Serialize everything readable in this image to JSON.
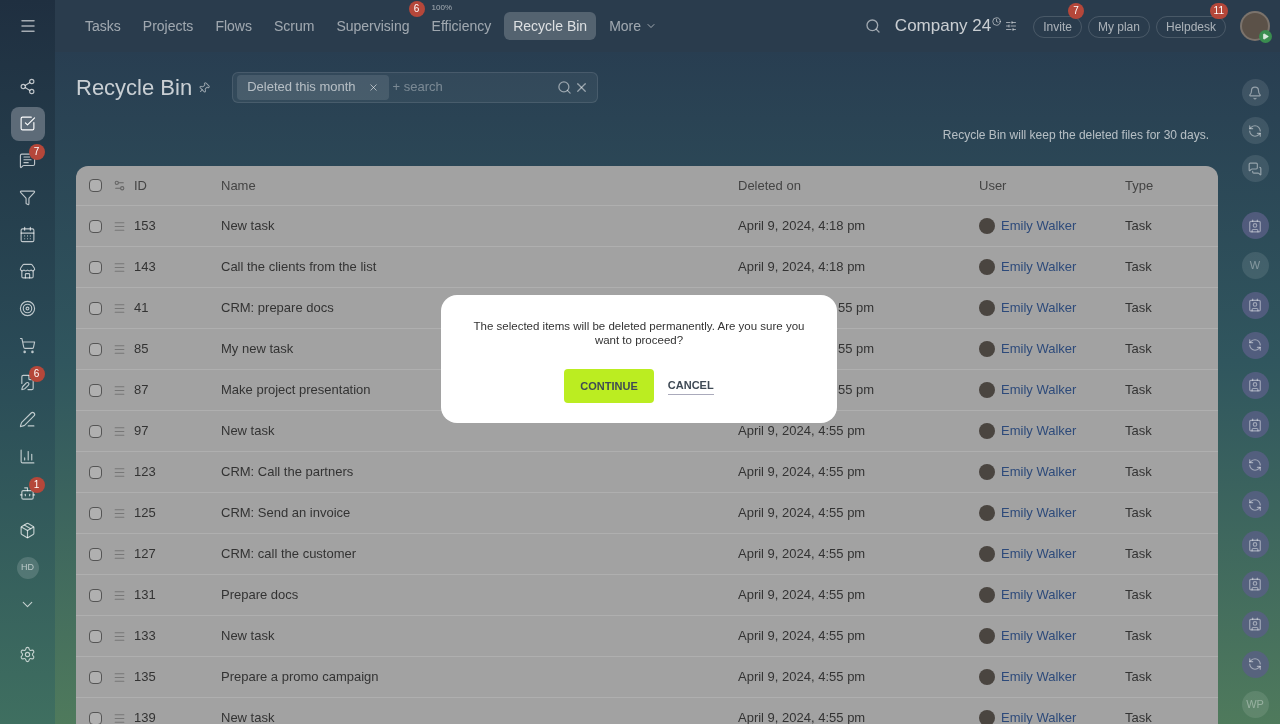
{
  "nav": {
    "items": [
      {
        "label": "Tasks",
        "selected": false
      },
      {
        "label": "Projects",
        "selected": false
      },
      {
        "label": "Flows",
        "selected": false
      },
      {
        "label": "Scrum",
        "selected": false
      },
      {
        "label": "Supervising",
        "selected": false,
        "badge": "6"
      },
      {
        "label": "Efficiency",
        "selected": false,
        "caption": "100%"
      },
      {
        "label": "Recycle Bin",
        "selected": true
      },
      {
        "label": "More",
        "selected": false,
        "dropdown": true
      }
    ],
    "company": "Company 24",
    "buttons": [
      {
        "label": "Invite",
        "badge": "7"
      },
      {
        "label": "My plan"
      },
      {
        "label": "Helpdesk",
        "badge": "11"
      }
    ]
  },
  "left_sidebar": [
    {
      "kind": "feed",
      "selected": false
    },
    {
      "kind": "tasks",
      "selected": true
    },
    {
      "kind": "chat",
      "selected": false,
      "badge": "7"
    },
    {
      "kind": "funnel",
      "selected": false
    },
    {
      "kind": "calendar",
      "selected": false
    },
    {
      "kind": "store",
      "selected": false
    },
    {
      "kind": "target",
      "selected": false
    },
    {
      "kind": "cart",
      "selected": false
    },
    {
      "kind": "docs",
      "selected": false,
      "badge": "6"
    },
    {
      "kind": "pen",
      "selected": false
    },
    {
      "kind": "chart",
      "selected": false
    },
    {
      "kind": "robot",
      "selected": false,
      "badge": "1"
    },
    {
      "kind": "box",
      "selected": false
    },
    {
      "kind": "initials",
      "selected": false,
      "text": "HD"
    },
    {
      "kind": "more",
      "selected": false
    },
    {
      "kind": "settings",
      "selected": false
    }
  ],
  "page": {
    "title": "Recycle Bin",
    "filter": {
      "tag": "Deleted this month",
      "placeholder": "+ search"
    },
    "note": "Recycle Bin will keep the deleted files for 30 days."
  },
  "table": {
    "all_checked": false,
    "columns": [
      "ID",
      "Name",
      "Deleted on",
      "User",
      "Type"
    ],
    "rows": [
      {
        "id": "153",
        "name": "New task",
        "deleted_on": "April 9, 2024, 4:18 pm",
        "user": "Emily Walker",
        "type": "Task",
        "checked": false
      },
      {
        "id": "143",
        "name": "Call the clients from the list",
        "deleted_on": "April 9, 2024, 4:18 pm",
        "user": "Emily Walker",
        "type": "Task",
        "checked": false
      },
      {
        "id": "41",
        "name": "CRM: prepare docs",
        "deleted_on": "55 pm",
        "covered": true,
        "user": "Emily Walker",
        "type": "Task",
        "checked": false
      },
      {
        "id": "85",
        "name": "My new task",
        "deleted_on": "55 pm",
        "covered": true,
        "user": "Emily Walker",
        "type": "Task",
        "checked": false
      },
      {
        "id": "87",
        "name": "Make project presentation",
        "deleted_on": "55 pm",
        "covered": true,
        "user": "Emily Walker",
        "type": "Task",
        "checked": false
      },
      {
        "id": "97",
        "name": "New task",
        "deleted_on": "April 9, 2024, 4:55 pm",
        "user": "Emily Walker",
        "type": "Task",
        "checked": false
      },
      {
        "id": "123",
        "name": "CRM: Call the partners",
        "deleted_on": "April 9, 2024, 4:55 pm",
        "user": "Emily Walker",
        "type": "Task",
        "checked": false
      },
      {
        "id": "125",
        "name": "CRM: Send an invoice",
        "deleted_on": "April 9, 2024, 4:55 pm",
        "user": "Emily Walker",
        "type": "Task",
        "checked": false
      },
      {
        "id": "127",
        "name": "CRM: call the customer",
        "deleted_on": "April 9, 2024, 4:55 pm",
        "user": "Emily Walker",
        "type": "Task",
        "checked": false
      },
      {
        "id": "131",
        "name": "Prepare docs",
        "deleted_on": "April 9, 2024, 4:55 pm",
        "user": "Emily Walker",
        "type": "Task",
        "checked": false
      },
      {
        "id": "133",
        "name": "New task",
        "deleted_on": "April 9, 2024, 4:55 pm",
        "user": "Emily Walker",
        "type": "Task",
        "checked": false
      },
      {
        "id": "135",
        "name": "Prepare a promo campaign",
        "deleted_on": "April 9, 2024, 4:55 pm",
        "user": "Emily Walker",
        "type": "Task",
        "checked": false
      },
      {
        "id": "139",
        "name": "New task",
        "deleted_on": "April 9, 2024, 4:55 pm",
        "user": "Emily Walker",
        "type": "Task",
        "checked": false
      }
    ]
  },
  "right_sidebar": {
    "tools": [
      {
        "kind": "bell"
      },
      {
        "kind": "swirl"
      },
      {
        "kind": "chat"
      }
    ],
    "chats": [
      {
        "kind": "contact"
      },
      {
        "kind": "letters",
        "text": "W"
      },
      {
        "kind": "contact"
      },
      {
        "kind": "swirl"
      },
      {
        "kind": "contact"
      },
      {
        "kind": "contact"
      },
      {
        "kind": "swirl"
      },
      {
        "kind": "swirl"
      },
      {
        "kind": "contact"
      },
      {
        "kind": "contact"
      },
      {
        "kind": "contact"
      },
      {
        "kind": "swirl"
      },
      {
        "kind": "letters",
        "text": "WP"
      }
    ]
  },
  "dialog": {
    "message": "The selected items will be deleted permanently. Are you sure you want to proceed?",
    "confirm": "CONTINUE",
    "cancel": "CANCEL"
  }
}
